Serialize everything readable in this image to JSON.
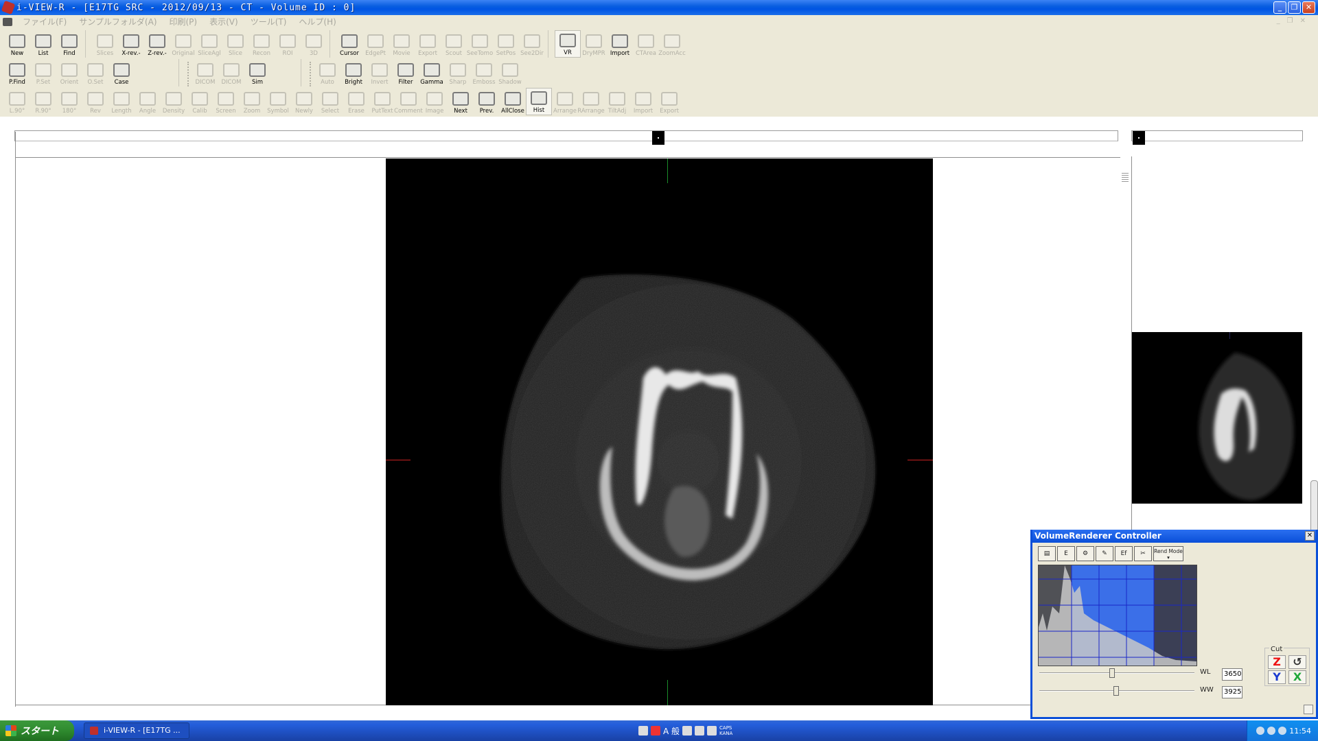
{
  "window": {
    "title": "i-VIEW-R - [E17TG SRC - 2012/09/13 - CT - Volume ID : 0]"
  },
  "menu": {
    "items": [
      "ファイル(F)",
      "サンプルフォルダ(A)",
      "印刷(P)",
      "表示(V)",
      "ツール(T)",
      "ヘルプ(H)"
    ]
  },
  "toolbar1": {
    "items": [
      {
        "label": "New",
        "icon": "new-icon",
        "enabled": true
      },
      {
        "label": "List",
        "icon": "list-icon",
        "enabled": true
      },
      {
        "label": "Find",
        "icon": "find-icon",
        "enabled": true
      },
      {
        "label": "Slices",
        "icon": "slices-icon",
        "enabled": false
      },
      {
        "label": "X-rev.-",
        "icon": "x-rev-icon",
        "enabled": true
      },
      {
        "label": "Z-rev.-",
        "icon": "z-rev-icon",
        "enabled": true
      },
      {
        "label": "Original",
        "icon": "original-icon",
        "enabled": false
      },
      {
        "label": "SliceAgl",
        "icon": "slice-angle-icon",
        "enabled": false
      },
      {
        "label": "Slice",
        "icon": "slice-icon",
        "enabled": false
      },
      {
        "label": "Recon",
        "icon": "recon-icon",
        "enabled": false
      },
      {
        "label": "ROI",
        "icon": "roi-icon",
        "enabled": false
      },
      {
        "label": "3D",
        "icon": "3d-icon",
        "enabled": false
      },
      {
        "label": "Cursor",
        "icon": "cursor-icon",
        "enabled": true
      },
      {
        "label": "EdgePt",
        "icon": "edge-point-icon",
        "enabled": false
      },
      {
        "label": "Movie",
        "icon": "movie-icon",
        "enabled": false
      },
      {
        "label": "Export",
        "icon": "export-icon",
        "enabled": false
      },
      {
        "label": "Scout",
        "icon": "scout-icon",
        "enabled": false
      },
      {
        "label": "SeeTomo",
        "icon": "see-tomo-icon",
        "enabled": false
      },
      {
        "label": "SetPos",
        "icon": "set-pos-icon",
        "enabled": false
      },
      {
        "label": "See2Dir",
        "icon": "see-2dir-icon",
        "enabled": false
      },
      {
        "label": "VR",
        "icon": "vr-icon",
        "enabled": true,
        "pressed": true
      },
      {
        "label": "DryMPR",
        "icon": "dry-mpr-icon",
        "enabled": false
      },
      {
        "label": "Import",
        "icon": "import-icon",
        "enabled": true
      },
      {
        "label": "CTArea",
        "icon": "ct-area-icon",
        "enabled": false
      },
      {
        "label": "ZoomAcc",
        "icon": "zoom-acc-icon",
        "enabled": false
      }
    ]
  },
  "toolbar2": {
    "group1": [
      {
        "label": "P.Find",
        "icon": "patient-find-icon",
        "enabled": true
      },
      {
        "label": "P.Set",
        "icon": "patient-set-icon",
        "enabled": false
      },
      {
        "label": "Orient",
        "icon": "orient-icon",
        "enabled": false
      },
      {
        "label": "O.Set",
        "icon": "orient-set-icon",
        "enabled": false
      },
      {
        "label": "Case",
        "icon": "case-icon",
        "enabled": true
      }
    ],
    "group2": [
      {
        "label": "DICOM",
        "icon": "dicom-icon",
        "enabled": false
      },
      {
        "label": "DICOM",
        "icon": "dicom-send-icon",
        "enabled": false
      },
      {
        "label": "Sim",
        "icon": "sim-icon",
        "enabled": true
      }
    ],
    "group3": [
      {
        "label": "Auto",
        "icon": "auto-icon",
        "enabled": false
      },
      {
        "label": "Bright",
        "icon": "bright-icon",
        "enabled": true
      },
      {
        "label": "Invert",
        "icon": "invert-icon",
        "enabled": false
      },
      {
        "label": "Filter",
        "icon": "filter-icon",
        "enabled": true
      },
      {
        "label": "Gamma",
        "icon": "gamma-icon",
        "enabled": true
      },
      {
        "label": "Sharp",
        "icon": "sharp-icon",
        "enabled": false
      },
      {
        "label": "Emboss",
        "icon": "emboss-icon",
        "enabled": false
      },
      {
        "label": "Shadow",
        "icon": "shadow-icon",
        "enabled": false
      }
    ]
  },
  "toolbar3": {
    "items": [
      {
        "label": "L.90°",
        "icon": "rotate-left-icon",
        "enabled": false
      },
      {
        "label": "R.90°",
        "icon": "rotate-right-icon",
        "enabled": false
      },
      {
        "label": "180°",
        "icon": "rotate-180-icon",
        "enabled": false
      },
      {
        "label": "Rev",
        "icon": "reverse-icon",
        "enabled": false
      },
      {
        "label": "Length",
        "icon": "length-icon",
        "enabled": false
      },
      {
        "label": "Angle",
        "icon": "angle-icon",
        "enabled": false
      },
      {
        "label": "Density",
        "icon": "density-icon",
        "enabled": false
      },
      {
        "label": "Calib",
        "icon": "calib-icon",
        "enabled": false
      },
      {
        "label": "Screen",
        "icon": "screen-icon",
        "enabled": false
      },
      {
        "label": "Zoom",
        "icon": "zoom-icon",
        "enabled": false
      },
      {
        "label": "Symbol",
        "icon": "symbol-icon",
        "enabled": false
      },
      {
        "label": "Newly",
        "icon": "newly-icon",
        "enabled": false
      },
      {
        "label": "Select",
        "icon": "select-icon",
        "enabled": false
      },
      {
        "label": "Erase",
        "icon": "erase-icon",
        "enabled": false
      },
      {
        "label": "PutText",
        "icon": "put-text-icon",
        "enabled": false
      },
      {
        "label": "Comment",
        "icon": "comment-icon",
        "enabled": false
      },
      {
        "label": "Image",
        "icon": "image-icon",
        "enabled": false
      },
      {
        "label": "Next",
        "icon": "next-arrow-icon",
        "enabled": true
      },
      {
        "label": "Prev.",
        "icon": "prev-arrow-icon",
        "enabled": true
      },
      {
        "label": "AllClose",
        "icon": "all-close-icon",
        "enabled": true
      },
      {
        "label": "Hist",
        "icon": "hist-icon",
        "enabled": true,
        "pressed": true
      },
      {
        "label": "Arrange",
        "icon": "arrange-icon",
        "enabled": false
      },
      {
        "label": "RArrange",
        "icon": "r-arrange-icon",
        "enabled": false
      },
      {
        "label": "TiltAdj",
        "icon": "tilt-adj-icon",
        "enabled": false
      },
      {
        "label": "Import",
        "icon": "import2-icon",
        "enabled": false
      },
      {
        "label": "Export",
        "icon": "export2-icon",
        "enabled": false
      }
    ]
  },
  "vr_controller": {
    "title": "VolumeRenderer Controller",
    "tools": [
      "▤",
      "E",
      "⚙",
      "✎",
      "Ef",
      "✂"
    ],
    "rend_mode_label": "Rend Mode",
    "wl_label": "WL",
    "ww_label": "WW",
    "wl_value": "3650",
    "ww_value": "3925",
    "cut_label": "Cut",
    "cut_z": "Z",
    "cut_y": "Y",
    "cut_x": "X",
    "undo_icon": "↺"
  },
  "taskbar": {
    "start_label": "スタート",
    "task_item": "i-VIEW-R - [E17TG ...",
    "ime_text": "A 般",
    "caps_label": "CAPS",
    "kana_label": "KANA",
    "clock": "11:54"
  }
}
